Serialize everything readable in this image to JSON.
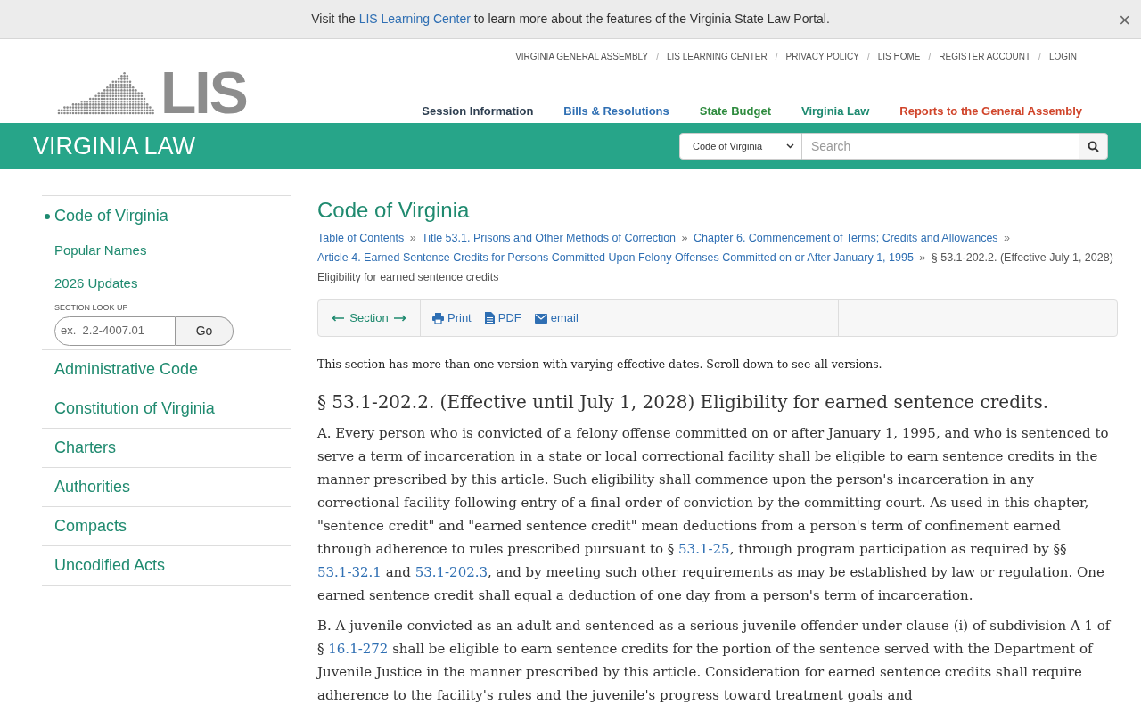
{
  "notice": {
    "parts": [
      {
        "text": "Visit the ",
        "link": false
      },
      {
        "text": "LIS Learning Center",
        "link": true
      },
      {
        "text": " to learn more about the features of the Virginia State Law Portal.",
        "link": false
      }
    ],
    "close": "×"
  },
  "utility_links": [
    "VIRGINIA GENERAL ASSEMBLY",
    "LIS LEARNING CENTER",
    "PRIVACY POLICY",
    "LIS HOME",
    "REGISTER ACCOUNT",
    "LOGIN"
  ],
  "utility_separator": "/",
  "logo": {
    "text": "LIS"
  },
  "main_nav": [
    {
      "label": "Session Information",
      "color": "#2d3e50"
    },
    {
      "label": "Bills & Resolutions",
      "color": "#2f6fb3"
    },
    {
      "label": "State Budget",
      "color": "#2e8b3e"
    },
    {
      "label": "Virginia Law",
      "color": "#1d8a70"
    },
    {
      "label": "Reports to the General Assembly",
      "color": "#d0442a"
    }
  ],
  "banner": {
    "title": "VIRGINIA LAW",
    "scope": "Code of Virginia",
    "search": {
      "placeholder": "Search"
    }
  },
  "sidebar": {
    "items": [
      {
        "label": "Code of Virginia",
        "selected": true,
        "children": [
          {
            "label": "Popular Names"
          },
          {
            "label": "2026 Updates"
          }
        ],
        "lookup": {
          "label": "SECTION LOOK UP",
          "placeholder": "ex.  2.2-4007.01",
          "button": "Go"
        }
      },
      {
        "label": "Administrative Code",
        "selected": false
      },
      {
        "label": "Constitution of Virginia",
        "selected": false
      },
      {
        "label": "Charters",
        "selected": false
      },
      {
        "label": "Authorities",
        "selected": false
      },
      {
        "label": "Compacts",
        "selected": false
      },
      {
        "label": "Uncodified Acts",
        "selected": false
      }
    ]
  },
  "content": {
    "title": "Code of Virginia",
    "breadcrumbs": [
      {
        "text": "Table of Contents",
        "link": true
      },
      {
        "text": "Title 53.1. Prisons and Other Methods of Correction",
        "link": true
      },
      {
        "text": "Chapter 6. Commencement of Terms; Credits and Allowances",
        "link": true
      },
      {
        "text": "Article 4. Earned Sentence Credits for Persons Committed Upon Felony Offenses Committed on or After January 1, 1995",
        "link": true
      },
      {
        "text": "§ 53.1-202.2. (Effective July 1, 2028) Eligibility for earned sentence credits",
        "link": false
      }
    ],
    "breadcrumb_separator": "»",
    "toolbar": {
      "section": "Section",
      "actions": [
        {
          "label": "Print",
          "kind": "print"
        },
        {
          "label": "PDF",
          "kind": "pdf"
        },
        {
          "label": "email",
          "kind": "email"
        }
      ]
    },
    "notice": "This section has more than one version with varying effective dates. Scroll down to see all versions.",
    "heading": "§ 53.1-202.2. (Effective until July 1, 2028) Eligibility for earned sentence credits.",
    "paragraphs": [
      [
        {
          "text": "A. Every person who is convicted of a felony offense committed on or after January 1, 1995, and who is sentenced to serve a term of incarceration in a state or local correctional facility shall be eligible to earn sentence credits in the manner prescribed by this article. Such eligibility shall commence upon the person's incarceration in any correctional facility following entry of a final order of conviction by the committing court. As used in this chapter, \"sentence credit\" and \"earned sentence credit\" mean deductions from a person's term of confinement earned through adherence to rules prescribed pursuant to § ",
          "link": false
        },
        {
          "text": "53.1-25",
          "link": true
        },
        {
          "text": ", through program participation as required by §§ ",
          "link": false
        },
        {
          "text": "53.1-32.1",
          "link": true
        },
        {
          "text": " and ",
          "link": false
        },
        {
          "text": "53.1-202.3",
          "link": true
        },
        {
          "text": ", and by meeting such other requirements as may be established by law or regulation. One earned sentence credit shall equal a deduction of one day from a person's term of incarceration.",
          "link": false
        }
      ],
      [
        {
          "text": "B. A juvenile convicted as an adult and sentenced as a serious juvenile offender under clause (i) of subdivision A 1 of § ",
          "link": false
        },
        {
          "text": "16.1-272",
          "link": true
        },
        {
          "text": " shall be eligible to earn sentence credits for the portion of the sentence served with the Department of Juvenile Justice in the manner prescribed by this article. Consideration for earned sentence credits shall require adherence to the facility's rules and the juvenile's progress toward treatment goals and",
          "link": false
        }
      ]
    ]
  }
}
